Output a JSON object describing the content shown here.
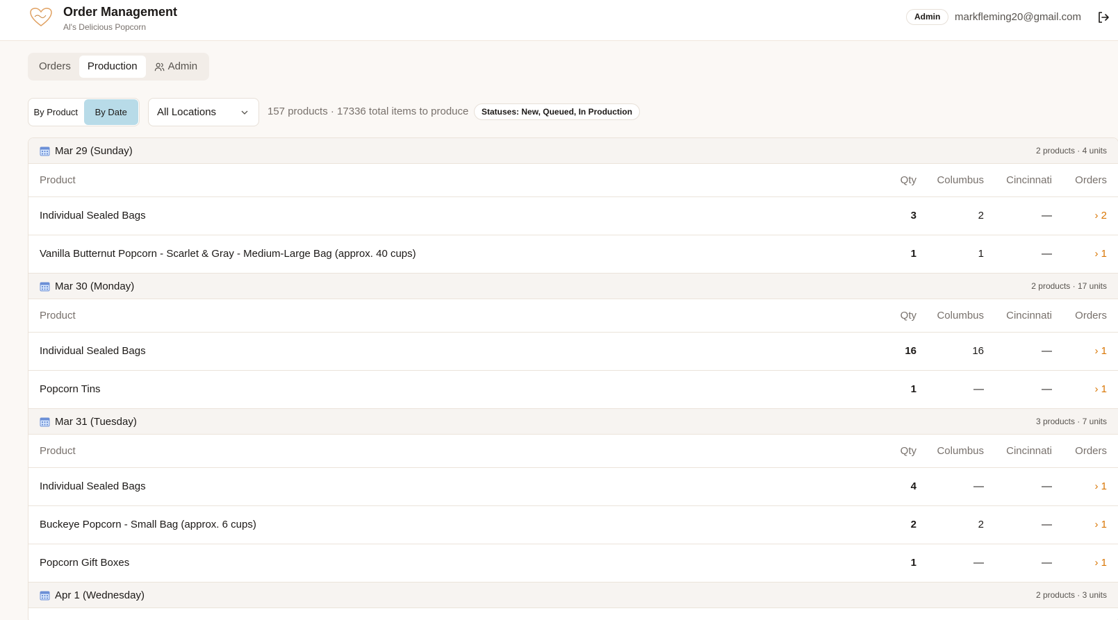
{
  "header": {
    "title": "Order Management",
    "subtitle": "Al's Delicious Popcorn",
    "role": "Admin",
    "email": "markfleming20@gmail.com"
  },
  "tabs": [
    {
      "label": "Orders",
      "active": false
    },
    {
      "label": "Production",
      "active": true
    },
    {
      "label": "Admin",
      "active": false,
      "icon": "users-icon"
    }
  ],
  "toolbar": {
    "view_by_product": "By Product",
    "view_by_date": "By Date",
    "active_view": "By Date",
    "location": "All Locations",
    "summary": "157 products · 17336 total items to produce",
    "status_filter": "Statuses: New, Queued, In Production"
  },
  "columns": {
    "product": "Product",
    "qty": "Qty",
    "columbus": "Columbus",
    "cincinnati": "Cincinnati",
    "orders": "Orders"
  },
  "days": [
    {
      "title": "Mar 29 (Sunday)",
      "meta": "2 products · 4 units",
      "rows": [
        {
          "product": "Individual Sealed Bags",
          "qty": "3",
          "columbus": "2",
          "cincinnati": "—",
          "orders": "› 2"
        },
        {
          "product": "Vanilla Butternut Popcorn - Scarlet & Gray - Medium-Large Bag (approx. 40 cups)",
          "qty": "1",
          "columbus": "1",
          "cincinnati": "—",
          "orders": "› 1"
        }
      ]
    },
    {
      "title": "Mar 30 (Monday)",
      "meta": "2 products · 17 units",
      "rows": [
        {
          "product": "Individual Sealed Bags",
          "qty": "16",
          "columbus": "16",
          "cincinnati": "—",
          "orders": "› 1"
        },
        {
          "product": "Popcorn Tins",
          "qty": "1",
          "columbus": "—",
          "cincinnati": "—",
          "orders": "› 1"
        }
      ]
    },
    {
      "title": "Mar 31 (Tuesday)",
      "meta": "3 products · 7 units",
      "rows": [
        {
          "product": "Individual Sealed Bags",
          "qty": "4",
          "columbus": "—",
          "cincinnati": "—",
          "orders": "› 1"
        },
        {
          "product": "Buckeye Popcorn - Small Bag (approx. 6 cups)",
          "qty": "2",
          "columbus": "2",
          "cincinnati": "—",
          "orders": "› 1"
        },
        {
          "product": "Popcorn Gift Boxes",
          "qty": "1",
          "columbus": "—",
          "cincinnati": "—",
          "orders": "› 1"
        }
      ]
    },
    {
      "title": "Apr 1 (Wednesday)",
      "meta": "2 products · 3 units",
      "rows": []
    }
  ],
  "colors": {
    "accent_orange": "#d97706",
    "active_view_bg": "#b8dbe8",
    "page_bg": "#fbf8f5"
  }
}
